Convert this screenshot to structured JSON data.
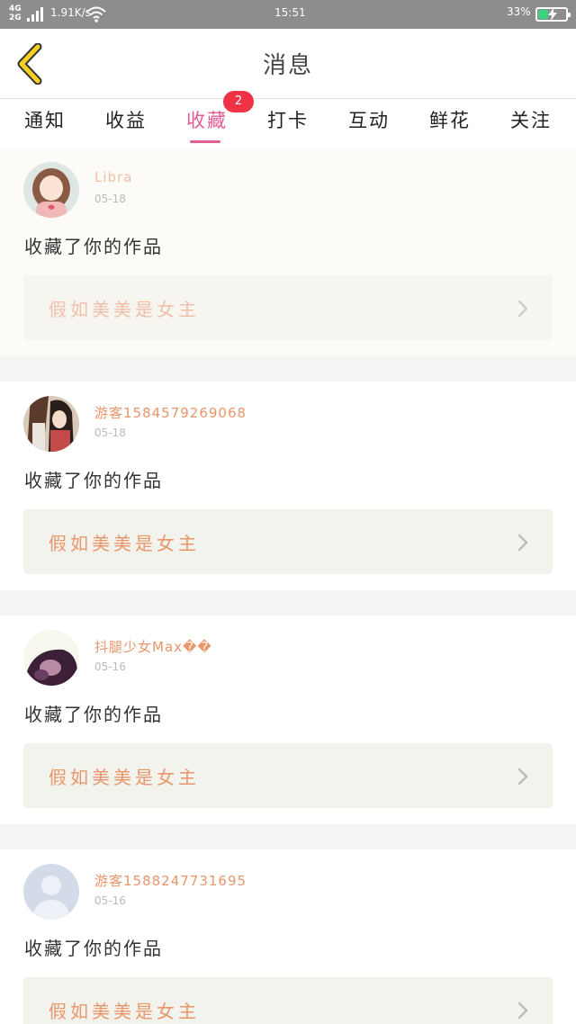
{
  "status_bar": {
    "network": "4G\n2G",
    "speed": "1.91K/s",
    "time": "15:51",
    "battery_pct": "33%",
    "battery_level": 0.33,
    "battery_color": "#3cd27e"
  },
  "nav": {
    "title": "消息",
    "back_icon": "chevron-left-icon",
    "back_color": "#f5d020"
  },
  "tabs": [
    {
      "label": "通知",
      "active": false
    },
    {
      "label": "收益",
      "active": false
    },
    {
      "label": "收藏",
      "active": true,
      "badge": "2"
    },
    {
      "label": "打卡",
      "active": false
    },
    {
      "label": "互动",
      "active": false
    },
    {
      "label": "鲜花",
      "active": false
    },
    {
      "label": "关注",
      "active": false
    }
  ],
  "accent_color": "#e45c93",
  "items": [
    {
      "user": "Libra",
      "date": "05-18",
      "action": "收藏了你的作品",
      "work": "假如美美是女主"
    },
    {
      "user": "游客15845792690​68",
      "date": "05-18",
      "action": "收藏了你的作品",
      "work": "假如美美是女主"
    },
    {
      "user": "抖腿少女Max��",
      "date": "05-16",
      "action": "收藏了你的作品",
      "work": "假如美美是女主"
    },
    {
      "user": "游客15882477316​95",
      "date": "05-16",
      "action": "收藏了你的作品",
      "work": "假如美美是女主"
    }
  ]
}
